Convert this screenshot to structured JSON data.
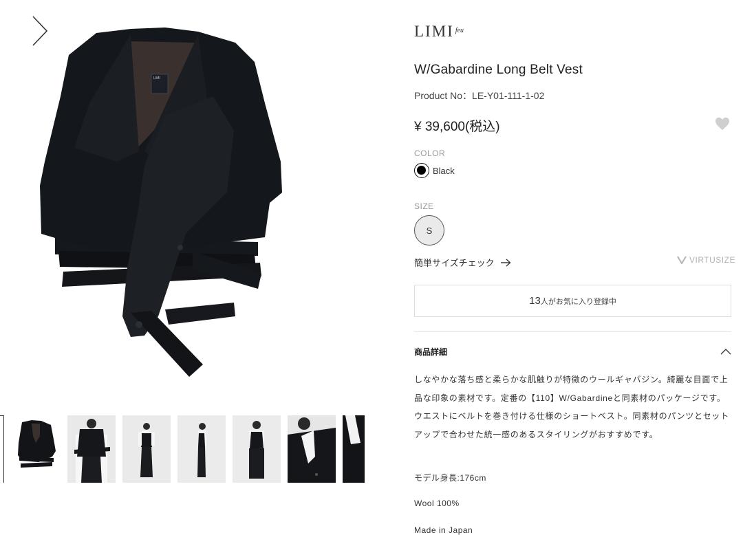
{
  "brand": {
    "name": "LIMI",
    "suffix": "feu"
  },
  "product": {
    "title": "W/Gabardine Long Belt Vest",
    "product_no": "Product No：LE-Y01-111-1-02",
    "price": "¥ 39,600(税込)"
  },
  "color": {
    "label": "COLOR",
    "selected": "Black",
    "swatch_hex": "#000000"
  },
  "size": {
    "label": "SIZE",
    "options": [
      "S"
    ]
  },
  "size_check": {
    "label": "簡単サイズチェック"
  },
  "virtusize": {
    "label": "VIRTUSIZE"
  },
  "favorites": {
    "count": "13",
    "suffix": "人がお気に入り登録中"
  },
  "detail": {
    "header": "商品詳細",
    "description": "しなやかな落ち感と柔らかな肌触りが特徴のウールギャバジン。綺麗な目面で上品な印象の素材です。定番の【110】W/Gabardineと同素材のパッケージです。",
    "description2": "ウエストにベルトを巻き付ける仕様のショートベスト。同素材のパンツとセットアップで合わせた統一感のあるスタイリングがおすすめです。",
    "model_height": "モデル身長:176cm",
    "material": "Wool 100%",
    "origin": "Made in Japan"
  },
  "gallery": {
    "icons": {
      "next": "chevron-right-icon",
      "favorite": "heart-icon",
      "size_check": "arrow-right-icon",
      "collapse": "chevron-up-icon"
    },
    "thumbnail_count": 8
  },
  "colors": {
    "text": "#222222",
    "muted": "#999999",
    "border": "#dcdcdc",
    "product": "#101216"
  }
}
